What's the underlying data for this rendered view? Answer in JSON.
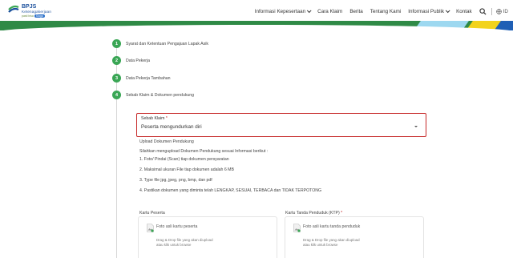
{
  "header": {
    "logo": {
      "title": "BPJS",
      "subtitle": "Ketenagakerjaan",
      "tagline": "pasti bisa",
      "tagline_pill": "Siaga"
    },
    "nav": [
      {
        "label": "Informasi Kepesertaan",
        "dropdown": true
      },
      {
        "label": "Cara Klaim",
        "dropdown": false
      },
      {
        "label": "Berita",
        "dropdown": false
      },
      {
        "label": "Tentang Kami",
        "dropdown": false
      },
      {
        "label": "Informasi Publik",
        "dropdown": true
      },
      {
        "label": "Kontak",
        "dropdown": false
      }
    ],
    "search_icon": "search-icon",
    "language": "ID",
    "language_icon": "globe-icon"
  },
  "colors": {
    "brand_green": "#3aa655",
    "banner_green": "#2f8a46",
    "brand_blue": "#1a4f9c",
    "error_red": "#c62828",
    "accent_yellow": "#f2d31c",
    "accent_light_blue": "#9dd8f0"
  },
  "steps": [
    {
      "number": "1",
      "label": "Syarat dan Ketentuan Pengajuan Lapak Asik"
    },
    {
      "number": "2",
      "label": "Data Pekerja"
    },
    {
      "number": "3",
      "label": "Data Pekerja Tambahan"
    },
    {
      "number": "4",
      "label": "Sebab Klaim & Dokumen pendukung"
    }
  ],
  "form": {
    "sebab_klaim_label": "Sebab Klaim",
    "required_mark": "*",
    "sebab_klaim_value": "Peserta mengundurkan diri",
    "upload_title": "Upload Dokumen Pendukung",
    "info_intro": "Silahkan mengupload Dokumen Pendukung sesuai Informasi berikut :",
    "info_items": [
      "1. Foto/ Pindai (Scan) tiap dokumen persyaratan",
      "2. Maksimal ukuran File tiap dokumen adalah 6 MB",
      "3. Type file jpg, jpeg, png, bmp, dan pdf",
      "4. Pastikan dokumen yang diminta telah LENGKAP, SESUAI, TERBACA dan TIDAK TERPOTONG"
    ]
  },
  "uploads": [
    {
      "label": "Kartu Peserta",
      "required": false,
      "title": "Foto asli kartu peserta",
      "desc_line1": "Drag & Drop file yang akan diupload",
      "desc_line2": "atau klik untuk browse",
      "icon": "image-file-icon"
    },
    {
      "label": "Kartu Tanda Penduduk (KTP)",
      "required": true,
      "title": "Foto asli kartu tanda penduduk",
      "desc_line1": "Drag & Drop file yang akan diupload",
      "desc_line2": "atau klik untuk browse",
      "icon": "image-file-icon"
    }
  ]
}
